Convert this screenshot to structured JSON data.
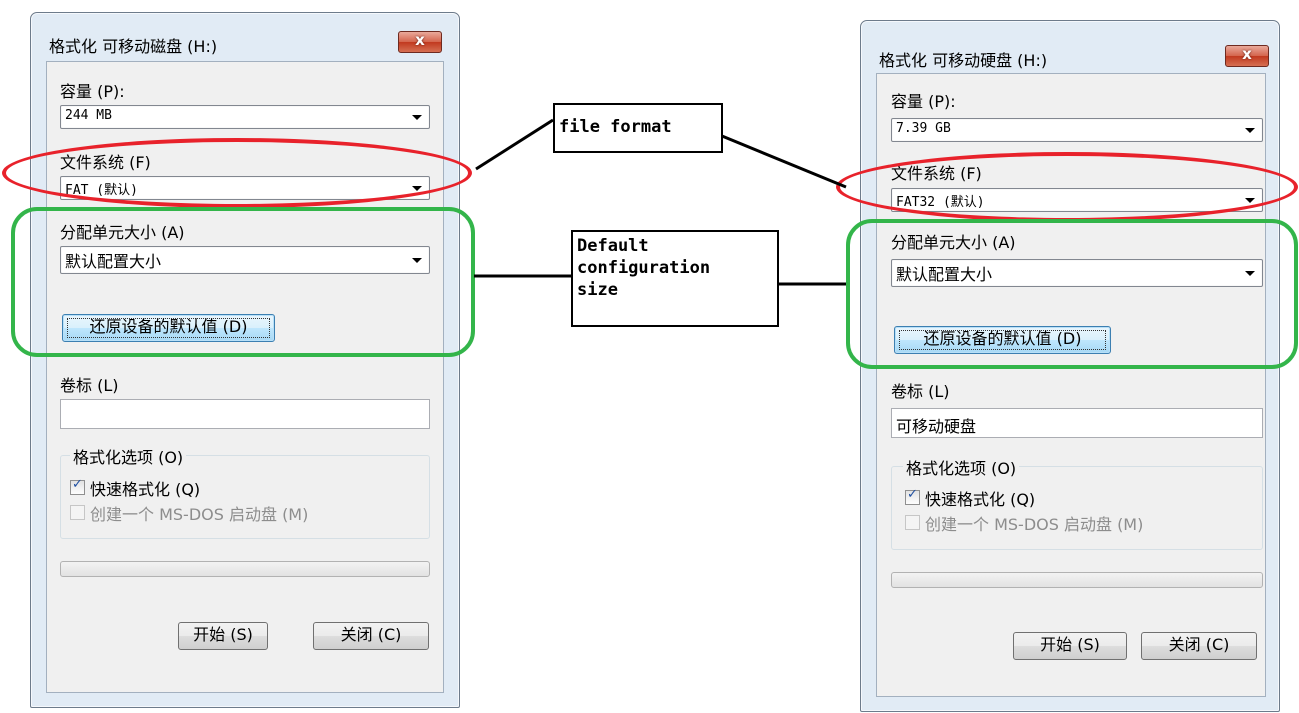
{
  "left_dialog": {
    "title": "格式化 可移动磁盘 (H:)",
    "close_label": "x",
    "capacity_label": "容量 (P):",
    "capacity_value": "244 MB",
    "filesystem_label": "文件系统 (F)",
    "filesystem_value": "FAT (默认)",
    "alloc_label": "分配单元大小 (A)",
    "alloc_value": "默认配置大小",
    "restore_button": "还原设备的默认值 (D)",
    "volume_label": "卷标 (L)",
    "volume_value": "",
    "format_options_title": "格式化选项 (O)",
    "quick_format_label": "快速格式化 (Q)",
    "quick_format_checked": true,
    "msdos_label": "创建一个 MS-DOS 启动盘 (M)",
    "msdos_checked": false,
    "start_button": "开始 (S)",
    "close_button": "关闭 (C)"
  },
  "right_dialog": {
    "title": "格式化 可移动硬盘 (H:)",
    "close_label": "x",
    "capacity_label": "容量 (P):",
    "capacity_value": "7.39 GB",
    "filesystem_label": "文件系统 (F)",
    "filesystem_value": "FAT32 (默认)",
    "alloc_label": "分配单元大小 (A)",
    "alloc_value": "默认配置大小",
    "restore_button": "还原设备的默认值 (D)",
    "volume_label": "卷标 (L)",
    "volume_value": "可移动硬盘",
    "format_options_title": "格式化选项 (O)",
    "quick_format_label": "快速格式化 (Q)",
    "quick_format_checked": true,
    "msdos_label": "创建一个 MS-DOS 启动盘 (M)",
    "msdos_checked": false,
    "start_button": "开始 (S)",
    "close_button": "关闭 (C)"
  },
  "annotations": {
    "file_format": "file format",
    "default_config": "Default\nconfiguration\nsize"
  },
  "colors": {
    "highlight_red": "#e8222b",
    "highlight_green": "#33b54a"
  }
}
